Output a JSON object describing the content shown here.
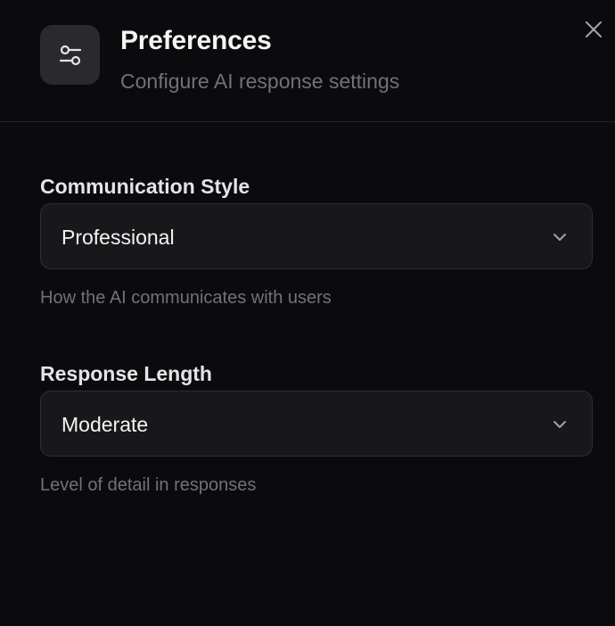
{
  "header": {
    "icon": "sliders-icon",
    "title": "Preferences",
    "subtitle": "Configure AI response settings",
    "close_icon": "close-icon"
  },
  "fields": [
    {
      "label": "Communication Style",
      "value": "Professional",
      "helper": "How the AI communicates with users"
    },
    {
      "label": "Response Length",
      "value": "Moderate",
      "helper": "Level of detail in responses"
    }
  ],
  "colors": {
    "background": "#0b0b0d",
    "select_background": "#18181b",
    "muted_text": "#71717a"
  }
}
